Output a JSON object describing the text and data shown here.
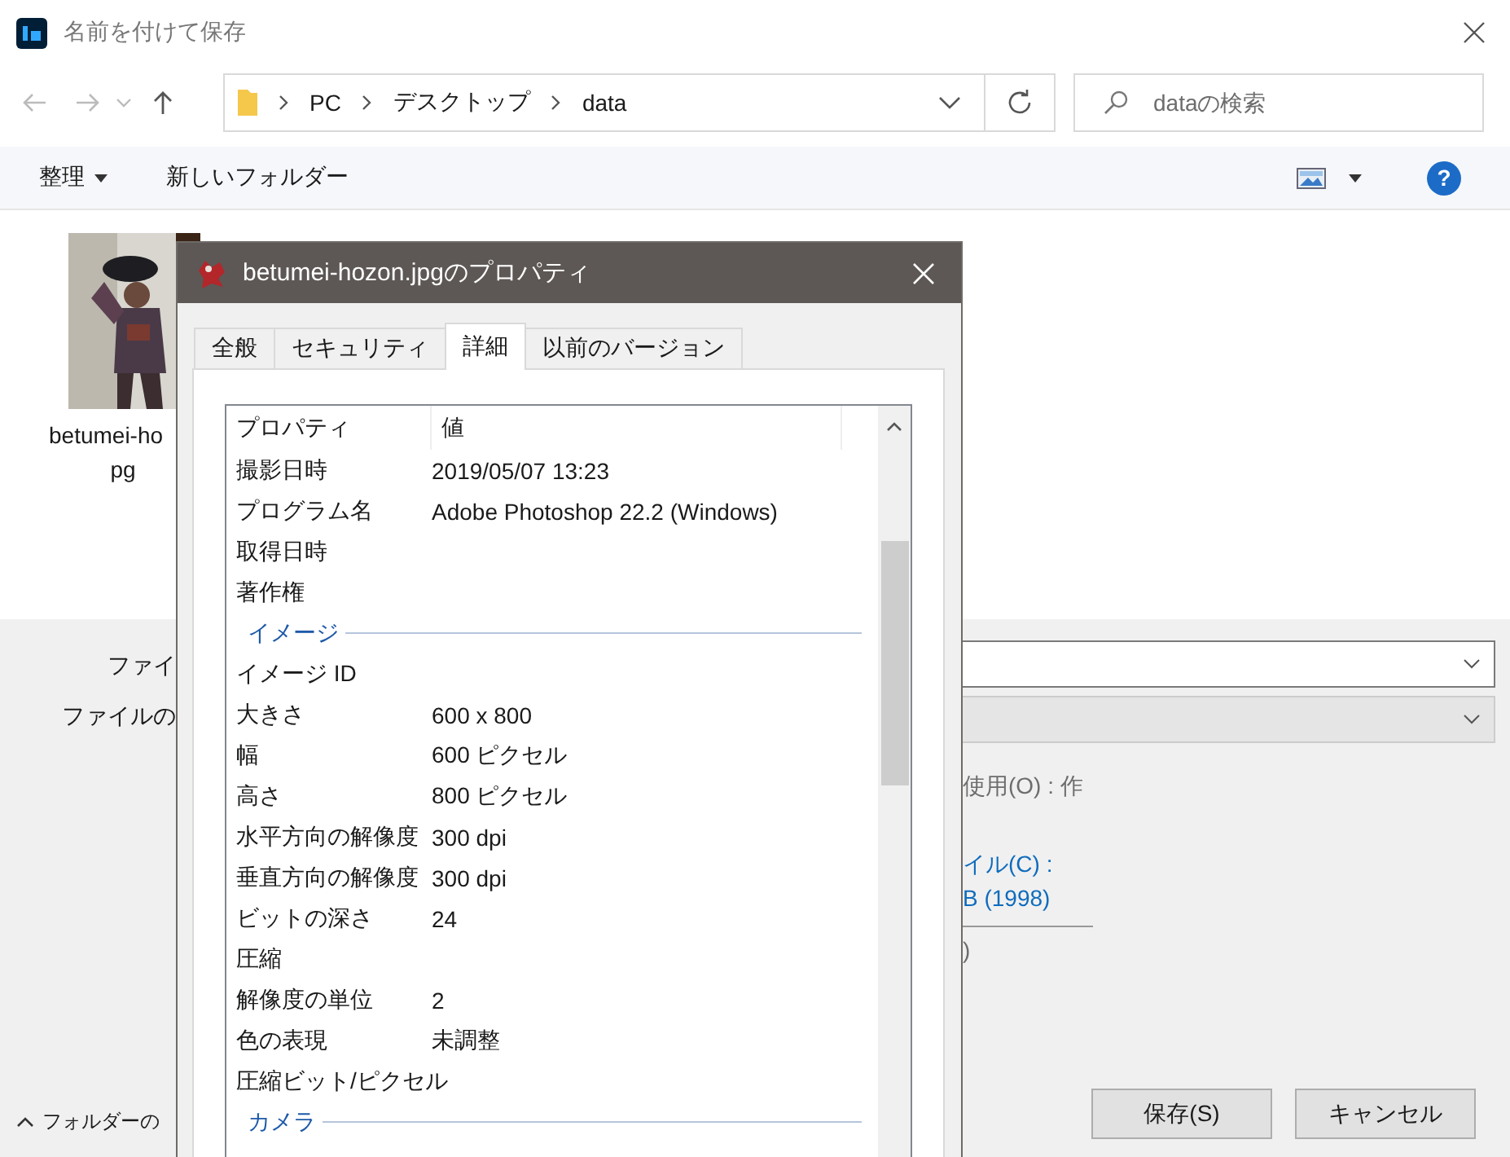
{
  "window": {
    "title": "名前を付けて保存"
  },
  "address_bar": {
    "path": [
      "PC",
      "デスクトップ",
      "data"
    ]
  },
  "search": {
    "placeholder": "dataの検索"
  },
  "toolbar": {
    "organize": "整理",
    "new_folder": "新しいフォルダー",
    "help": "?"
  },
  "files": [
    {
      "kind": "picture",
      "name_lines": [
        "betumei-ho",
        "pg"
      ]
    }
  ],
  "form": {
    "labels": [
      "ファイ",
      "ファイルの"
    ],
    "notes": [
      {
        "kind": "plain",
        "text": "使用(O) : 作"
      },
      {
        "kind": "link",
        "text": "イル(C) :"
      },
      {
        "kind": "link",
        "text": "B (1998)"
      },
      {
        "kind": "plain",
        "text": ")"
      }
    ]
  },
  "folder_toggle": "フォルダーの",
  "buttons": [
    "保存(S)",
    "キャンセル"
  ],
  "properties_dialog": {
    "title": "betumei-hozon.jpgのプロパティ",
    "tabs": [
      {
        "label": "全般",
        "selected": false
      },
      {
        "label": "セキュリティ",
        "selected": false
      },
      {
        "label": "詳細",
        "selected": true
      },
      {
        "label": "以前のバージョン",
        "selected": false
      }
    ],
    "columns": [
      "プロパティ",
      "値"
    ],
    "rows": [
      {
        "kind": "row",
        "name": "撮影日時",
        "value": "2019/05/07 13:23"
      },
      {
        "kind": "row",
        "name": "プログラム名",
        "value": "Adobe Photoshop 22.2 (Windows)"
      },
      {
        "kind": "row",
        "name": "取得日時"
      },
      {
        "kind": "row",
        "name": "著作権"
      },
      {
        "kind": "group",
        "name": "イメージ"
      },
      {
        "kind": "row",
        "name": "イメージ ID"
      },
      {
        "kind": "row",
        "name": "大きさ",
        "value": "600 x 800"
      },
      {
        "kind": "row",
        "name": "幅",
        "value": "600 ピクセル"
      },
      {
        "kind": "row",
        "name": "高さ",
        "value": "800 ピクセル"
      },
      {
        "kind": "row",
        "name": "水平方向の解像度",
        "value": "300 dpi"
      },
      {
        "kind": "row",
        "name": "垂直方向の解像度",
        "value": "300 dpi"
      },
      {
        "kind": "row",
        "name": "ビットの深さ",
        "value": "24"
      },
      {
        "kind": "row",
        "name": "圧縮"
      },
      {
        "kind": "row",
        "name": "解像度の単位",
        "value": "2"
      },
      {
        "kind": "row",
        "name": "色の表現",
        "value": "未調整"
      },
      {
        "kind": "row",
        "name": "圧縮ビット/ピクセル"
      },
      {
        "kind": "group",
        "name": "カメラ"
      }
    ]
  }
}
